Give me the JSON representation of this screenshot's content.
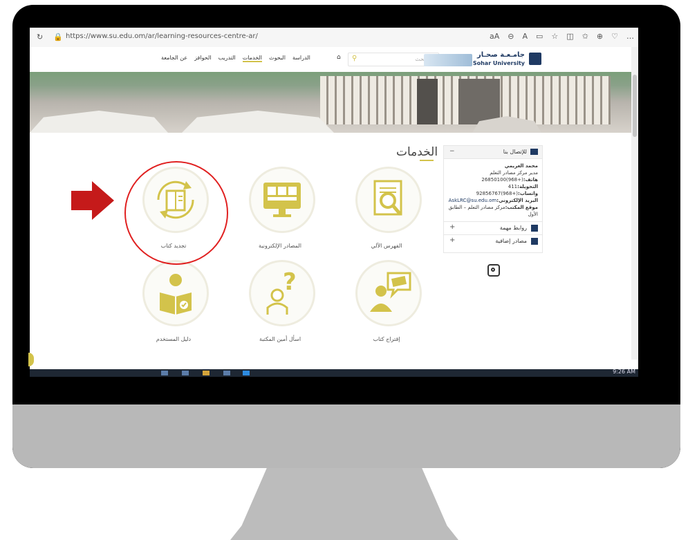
{
  "browser": {
    "url": "https://www.su.edu.om/ar/learning-resources-centre-ar/",
    "toolbar_icons": [
      "reading-view-icon",
      "zoom-icon",
      "read-aloud-icon",
      "split-icon",
      "favorite-icon",
      "sidebar-icon",
      "favorites-icon",
      "collections-icon",
      "extensions-icon",
      "more-icon"
    ]
  },
  "site": {
    "logo_ar": "جامـعـة صحـار",
    "logo_en": "Sohar University",
    "search_placeholder": "البحث...",
    "nav": [
      "الدراسة",
      "البحوث",
      "الخدمات",
      "التدريب",
      "الحوافز",
      "عن الجامعة"
    ]
  },
  "services": {
    "title": "الخدمات",
    "items": [
      {
        "label": "الفهرس الآلي",
        "icon": "catalog-search-icon"
      },
      {
        "label": "المصادر الإلكترونية",
        "icon": "e-resources-monitor-icon"
      },
      {
        "label": "تجديد كتاب",
        "icon": "book-renew-icon"
      },
      {
        "label": "إقتراح كتاب",
        "icon": "suggest-book-icon"
      },
      {
        "label": "اسأل أمين المكتبة",
        "icon": "ask-librarian-icon"
      },
      {
        "label": "دليل المستخدم",
        "icon": "user-guide-icon"
      }
    ]
  },
  "contact": {
    "title": "للإتصال بنا",
    "name": "محمد العريمي",
    "position": "مدير مركز مصادر التعلم",
    "phone_label": "هاتف:",
    "phone": "(+968)26850100",
    "ext_label": "التحويلة:",
    "ext": "411",
    "whatsapp_label": "واتساب:",
    "whatsapp": "(+968)92856767",
    "email_label": "البريد الإلكتروني:",
    "email": "AskLRC@su.edu.om",
    "office_label": "موقع المكتب:",
    "office": "مركز مصادر التعلم – الطابق الأول",
    "links": [
      "روابط مهمة",
      "مصادر إضافية"
    ]
  },
  "taskbar": {
    "time": "9:26 AM"
  },
  "colors": {
    "accent": "#d3c34b",
    "brand": "#1f3a63",
    "highlight": "#e02020"
  }
}
